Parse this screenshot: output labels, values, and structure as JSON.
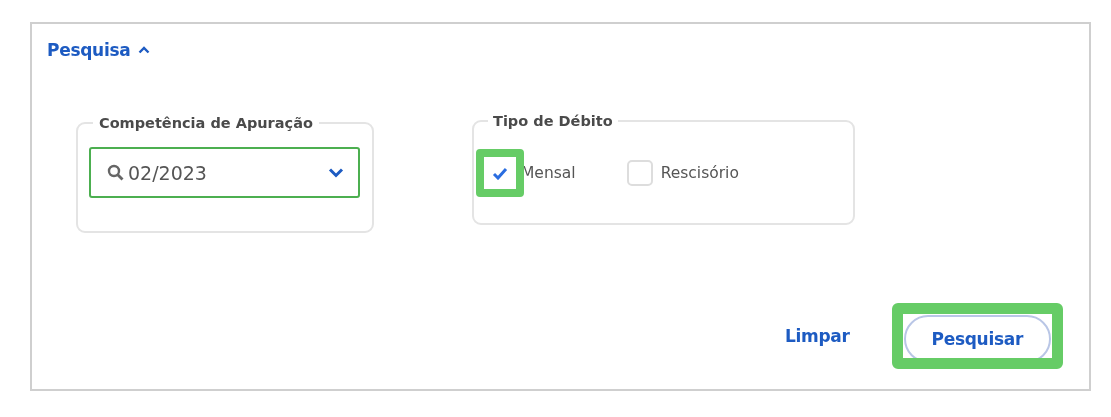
{
  "panel": {
    "title": "Pesquisa",
    "expanded": true
  },
  "competencia": {
    "label": "Competência de Apuração",
    "value": "02/2023"
  },
  "tipo_debito": {
    "label": "Tipo de Débito",
    "options": [
      {
        "label": "Mensal",
        "checked": true,
        "highlighted": true
      },
      {
        "label": "Rescisório",
        "checked": false,
        "highlighted": false
      }
    ]
  },
  "buttons": [
    {
      "label": "Limpar",
      "kind": "link",
      "highlighted": false
    },
    {
      "label": "Pesquisar",
      "kind": "primary",
      "highlighted": true
    }
  ]
}
